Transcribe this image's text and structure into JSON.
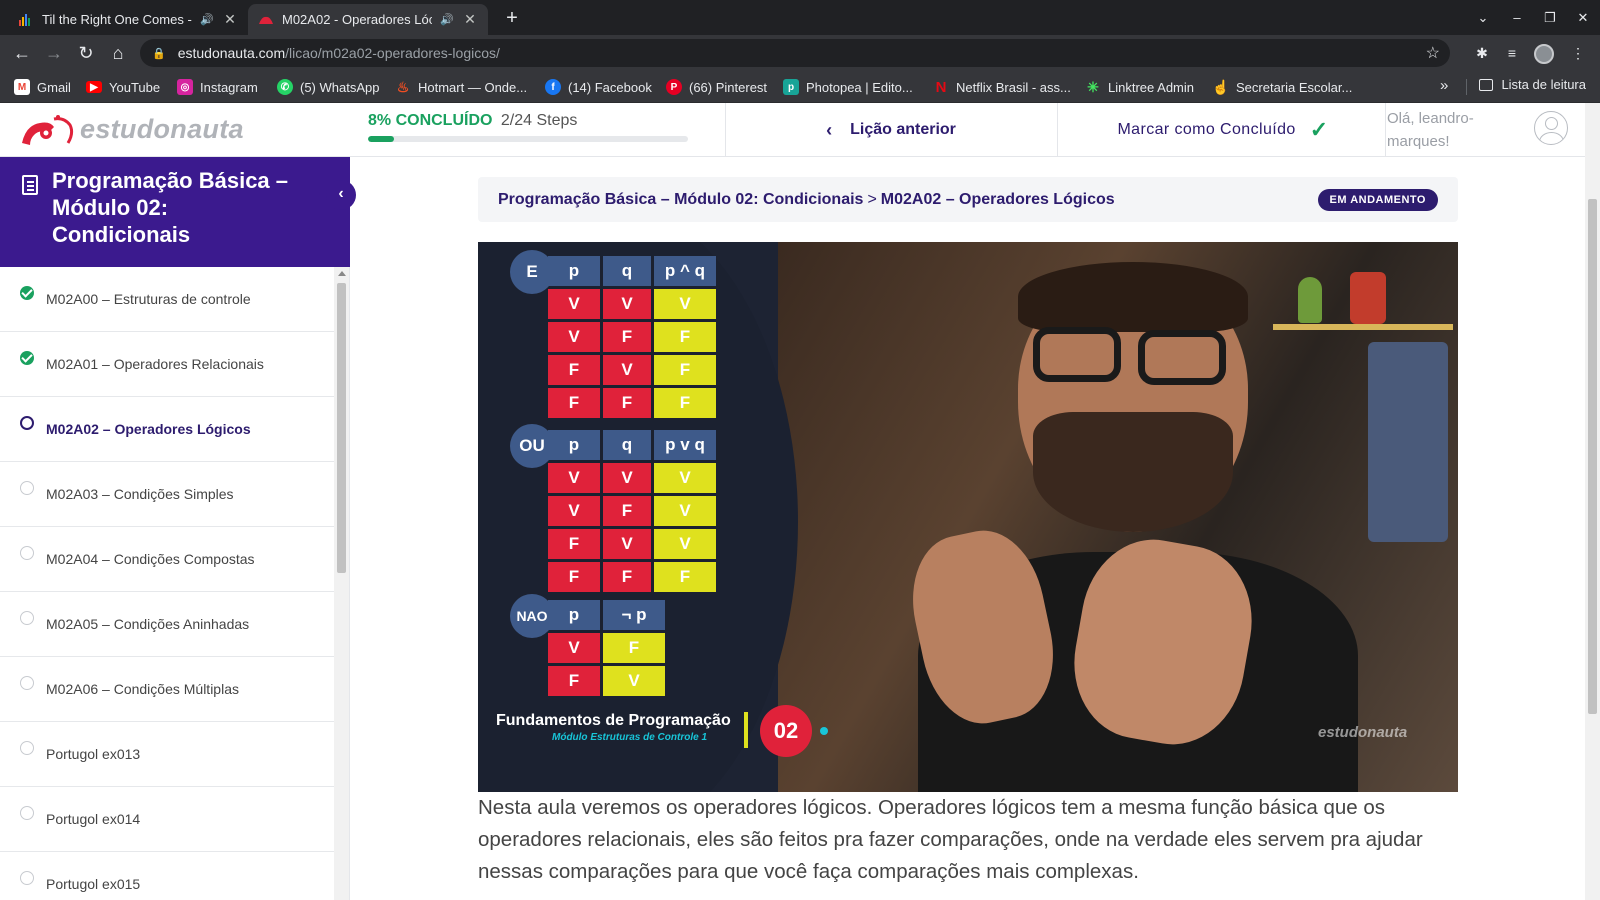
{
  "browser": {
    "tabs": [
      {
        "title": "Til the Right One Comes -",
        "audio": "🔊",
        "active": false
      },
      {
        "title": "M02A02 - Operadores Lóc",
        "audio": "🔊",
        "active": true
      }
    ],
    "new_tab": "+",
    "url_host": "estudonauta.com",
    "url_path": "/licao/m02a02-operadores-logicos/",
    "bookmarks": [
      {
        "label": "Gmail",
        "icon": "gmail-icon",
        "color": "#ea4335"
      },
      {
        "label": "YouTube",
        "icon": "youtube-icon",
        "color": "#ff0000"
      },
      {
        "label": "Instagram",
        "icon": "instagram-icon",
        "color": "#d6249f"
      },
      {
        "label": "(5) WhatsApp",
        "icon": "whatsapp-icon",
        "color": "#25d366"
      },
      {
        "label": "Hotmart — Onde...",
        "icon": "hotmart-icon",
        "color": "#f04e23"
      },
      {
        "label": "(14) Facebook",
        "icon": "facebook-icon",
        "color": "#1877f2"
      },
      {
        "label": "(66) Pinterest",
        "icon": "pinterest-icon",
        "color": "#e60023"
      },
      {
        "label": "Photopea | Edito...",
        "icon": "photopea-icon",
        "color": "#18a497"
      },
      {
        "label": "Netflix Brasil - ass...",
        "icon": "netflix-icon",
        "color": "#e50914"
      },
      {
        "label": "Linktree Admin",
        "icon": "linktree-icon",
        "color": "#43e660"
      },
      {
        "label": "Secretaria Escolar...",
        "icon": "secretaria-icon",
        "color": "#4a8fe0"
      }
    ],
    "reading_list": "Lista de leitura"
  },
  "header": {
    "logo_text": "estudonauta",
    "progress_pct": "8% CONCLUÍDO",
    "progress_steps": "2/24 Steps",
    "progress_fraction": 0.08,
    "prev_lesson": "Lição anterior",
    "mark_complete": "Marcar como Concluído",
    "greeting": "Olá, leandro-marques!"
  },
  "sidebar": {
    "course_title": "Programação Básica – Módulo 02: Condicionais",
    "lessons": [
      {
        "label": "M02A00 – Estruturas de controle",
        "status": "done"
      },
      {
        "label": "M02A01 – Operadores Relacionais",
        "status": "done"
      },
      {
        "label": "M02A02 – Operadores Lógicos",
        "status": "current"
      },
      {
        "label": "M02A03 – Condições Simples",
        "status": "todo"
      },
      {
        "label": "M02A04 – Condições Compostas",
        "status": "todo"
      },
      {
        "label": "M02A05 – Condições Aninhadas",
        "status": "todo"
      },
      {
        "label": "M02A06 – Condições Múltiplas",
        "status": "todo"
      },
      {
        "label": "Portugol ex013",
        "status": "todo"
      },
      {
        "label": "Portugol ex014",
        "status": "todo"
      },
      {
        "label": "Portugol ex015",
        "status": "todo"
      }
    ]
  },
  "main": {
    "breadcrumb": {
      "course": "Programação Básica – Módulo 02: Condicionais",
      "separator": ">",
      "lesson": "M02A02 – Operadores Lógicos"
    },
    "status_badge": "EM ANDAMENTO",
    "video": {
      "and_table": {
        "label": "E",
        "headers": [
          "p",
          "q",
          "p ^ q"
        ],
        "rows": [
          [
            "V",
            "V",
            "V"
          ],
          [
            "V",
            "F",
            "F"
          ],
          [
            "F",
            "V",
            "F"
          ],
          [
            "F",
            "F",
            "F"
          ]
        ]
      },
      "or_table": {
        "label": "OU",
        "headers": [
          "p",
          "q",
          "p v q"
        ],
        "rows": [
          [
            "V",
            "V",
            "V"
          ],
          [
            "V",
            "F",
            "V"
          ],
          [
            "F",
            "V",
            "V"
          ],
          [
            "F",
            "F",
            "F"
          ]
        ]
      },
      "not_table": {
        "label": "NAO",
        "headers": [
          "p",
          "¬ p"
        ],
        "rows": [
          [
            "V",
            "F"
          ],
          [
            "F",
            "V"
          ]
        ]
      },
      "caption_title": "Fundamentos de Programação",
      "caption_subtitle": "Módulo Estruturas de Controle 1",
      "episode": "02",
      "watermark": "estudonauta"
    },
    "description": "Nesta aula veremos os operadores lógicos. Operadores lógicos tem a mesma função básica que os operadores relacionais, eles são feitos pra fazer comparações, onde na verdade eles servem pra ajudar nessas comparações para que você faça comparações mais complexas."
  }
}
